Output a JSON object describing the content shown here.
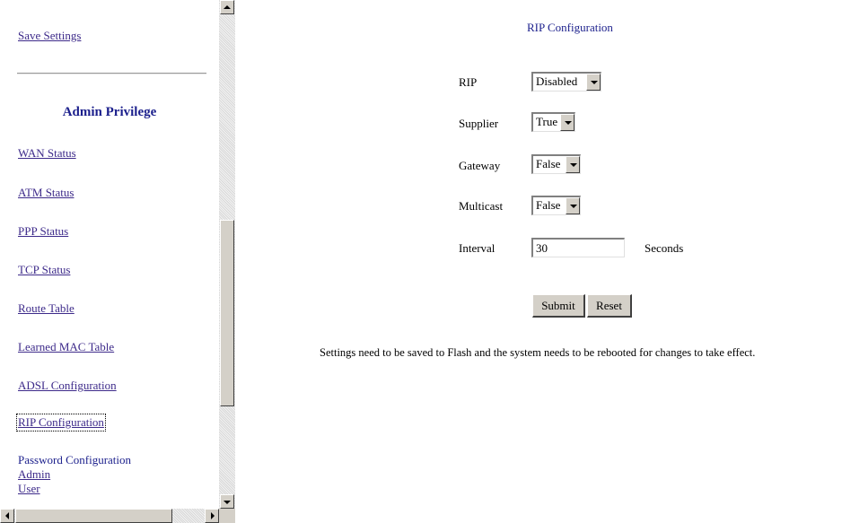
{
  "sidebar": {
    "links_top": [
      "Save Settings"
    ],
    "admin_heading": "Admin Privilege",
    "links": [
      "WAN Status",
      "ATM Status",
      "PPP Status",
      "TCP Status",
      "Route Table",
      "Learned MAC Table",
      "ADSL Configuration",
      "RIP Configuration"
    ],
    "password_heading": "Password Configuration",
    "password_links": [
      "Admin",
      "User"
    ]
  },
  "main": {
    "title": "RIP Configuration",
    "fields": {
      "rip": {
        "label": "RIP",
        "value": "Disabled"
      },
      "supplier": {
        "label": "Supplier",
        "value": "True"
      },
      "gateway": {
        "label": "Gateway",
        "value": "False"
      },
      "multicast": {
        "label": "Multicast",
        "value": "False"
      },
      "interval": {
        "label": "Interval",
        "value": "30",
        "unit": "Seconds"
      }
    },
    "buttons": {
      "submit": "Submit",
      "reset": "Reset"
    },
    "note": "Settings need to be saved to Flash and the system needs to be rebooted for changes to take effect."
  },
  "colors": {
    "link": "#3d2a8a",
    "heading": "#1b1f8c",
    "chrome": "#d4d0c8"
  }
}
